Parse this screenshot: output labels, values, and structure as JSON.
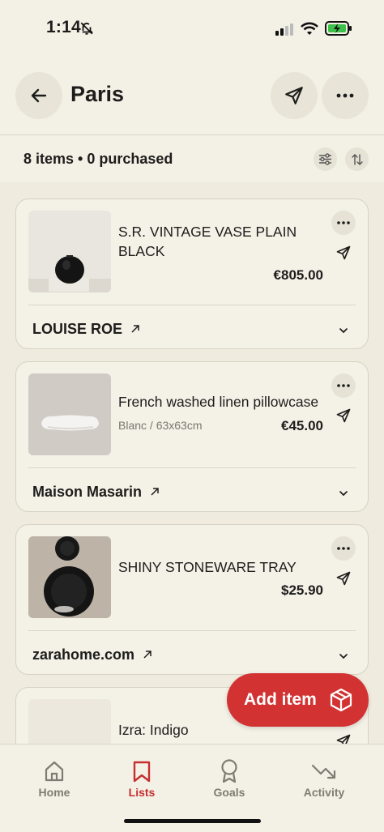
{
  "status_bar": {
    "time": "1:14"
  },
  "header": {
    "title": "Paris"
  },
  "summary": {
    "text": "8 items • 0 purchased"
  },
  "items": [
    {
      "name": "S.R. VINTAGE VASE PLAIN BLACK",
      "variant": "",
      "price": "€805.00",
      "store": "LOUISE ROE"
    },
    {
      "name": "French washed linen pillowcase",
      "variant": "Blanc / 63x63cm",
      "price": "€45.00",
      "store": "Maison Masarin"
    },
    {
      "name": "SHINY STONEWARE TRAY",
      "variant": "",
      "price": "$25.90",
      "store": "zarahome.com"
    },
    {
      "name": "Izra: Indigo",
      "variant": "",
      "price": "",
      "store": ""
    }
  ],
  "fab": {
    "label": "Add item"
  },
  "tabs": [
    {
      "label": "Home",
      "icon": "home-icon"
    },
    {
      "label": "Lists",
      "icon": "bookmark-icon"
    },
    {
      "label": "Goals",
      "icon": "award-icon"
    },
    {
      "label": "Activity",
      "icon": "trending-down-icon"
    }
  ],
  "colors": {
    "accent": "#d23332",
    "background": "#efebde",
    "card": "#f4f1e7"
  }
}
